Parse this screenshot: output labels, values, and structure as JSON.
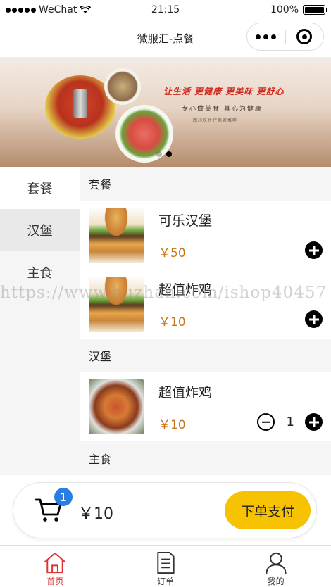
{
  "status_bar": {
    "carrier": "WeChat",
    "time": "21:15",
    "battery": "100%"
  },
  "navbar": {
    "title": "微服汇-点餐"
  },
  "banner": {
    "slogan": "让生活 更健康 更美味 更舒心",
    "subtitle": "专心做美食  真心为健康",
    "small_text": "四川吃住行商家推荐",
    "slides": 2,
    "active_slide": 2
  },
  "sidebar": {
    "categories": [
      {
        "label": "套餐"
      },
      {
        "label": "汉堡"
      },
      {
        "label": "主食"
      }
    ]
  },
  "menu": {
    "sections": [
      {
        "title": "套餐",
        "items": [
          {
            "name": "可乐汉堡",
            "price": "￥50",
            "image": "burger"
          },
          {
            "name": "超值炸鸡",
            "price": "￥10",
            "image": "burger"
          }
        ]
      },
      {
        "title": "汉堡",
        "items": [
          {
            "name": "超值炸鸡",
            "price": "￥10",
            "image": "noodle",
            "quantity": "1"
          }
        ]
      },
      {
        "title": "主食",
        "items": []
      }
    ]
  },
  "watermark": "https://www.huzhan.com/ishop40457",
  "cart": {
    "badge_count": "1",
    "total": "￥10",
    "checkout_label": "下单支付"
  },
  "tabbar": {
    "tabs": [
      {
        "label": "首页",
        "icon": "home-icon",
        "active": true
      },
      {
        "label": "订单",
        "icon": "document-icon",
        "active": false
      },
      {
        "label": "我的",
        "icon": "user-icon",
        "active": false
      }
    ]
  },
  "colors": {
    "accent": "#f7c300",
    "price": "#c8741a",
    "badge": "#2a7de1",
    "active_tab": "#dd3333"
  }
}
